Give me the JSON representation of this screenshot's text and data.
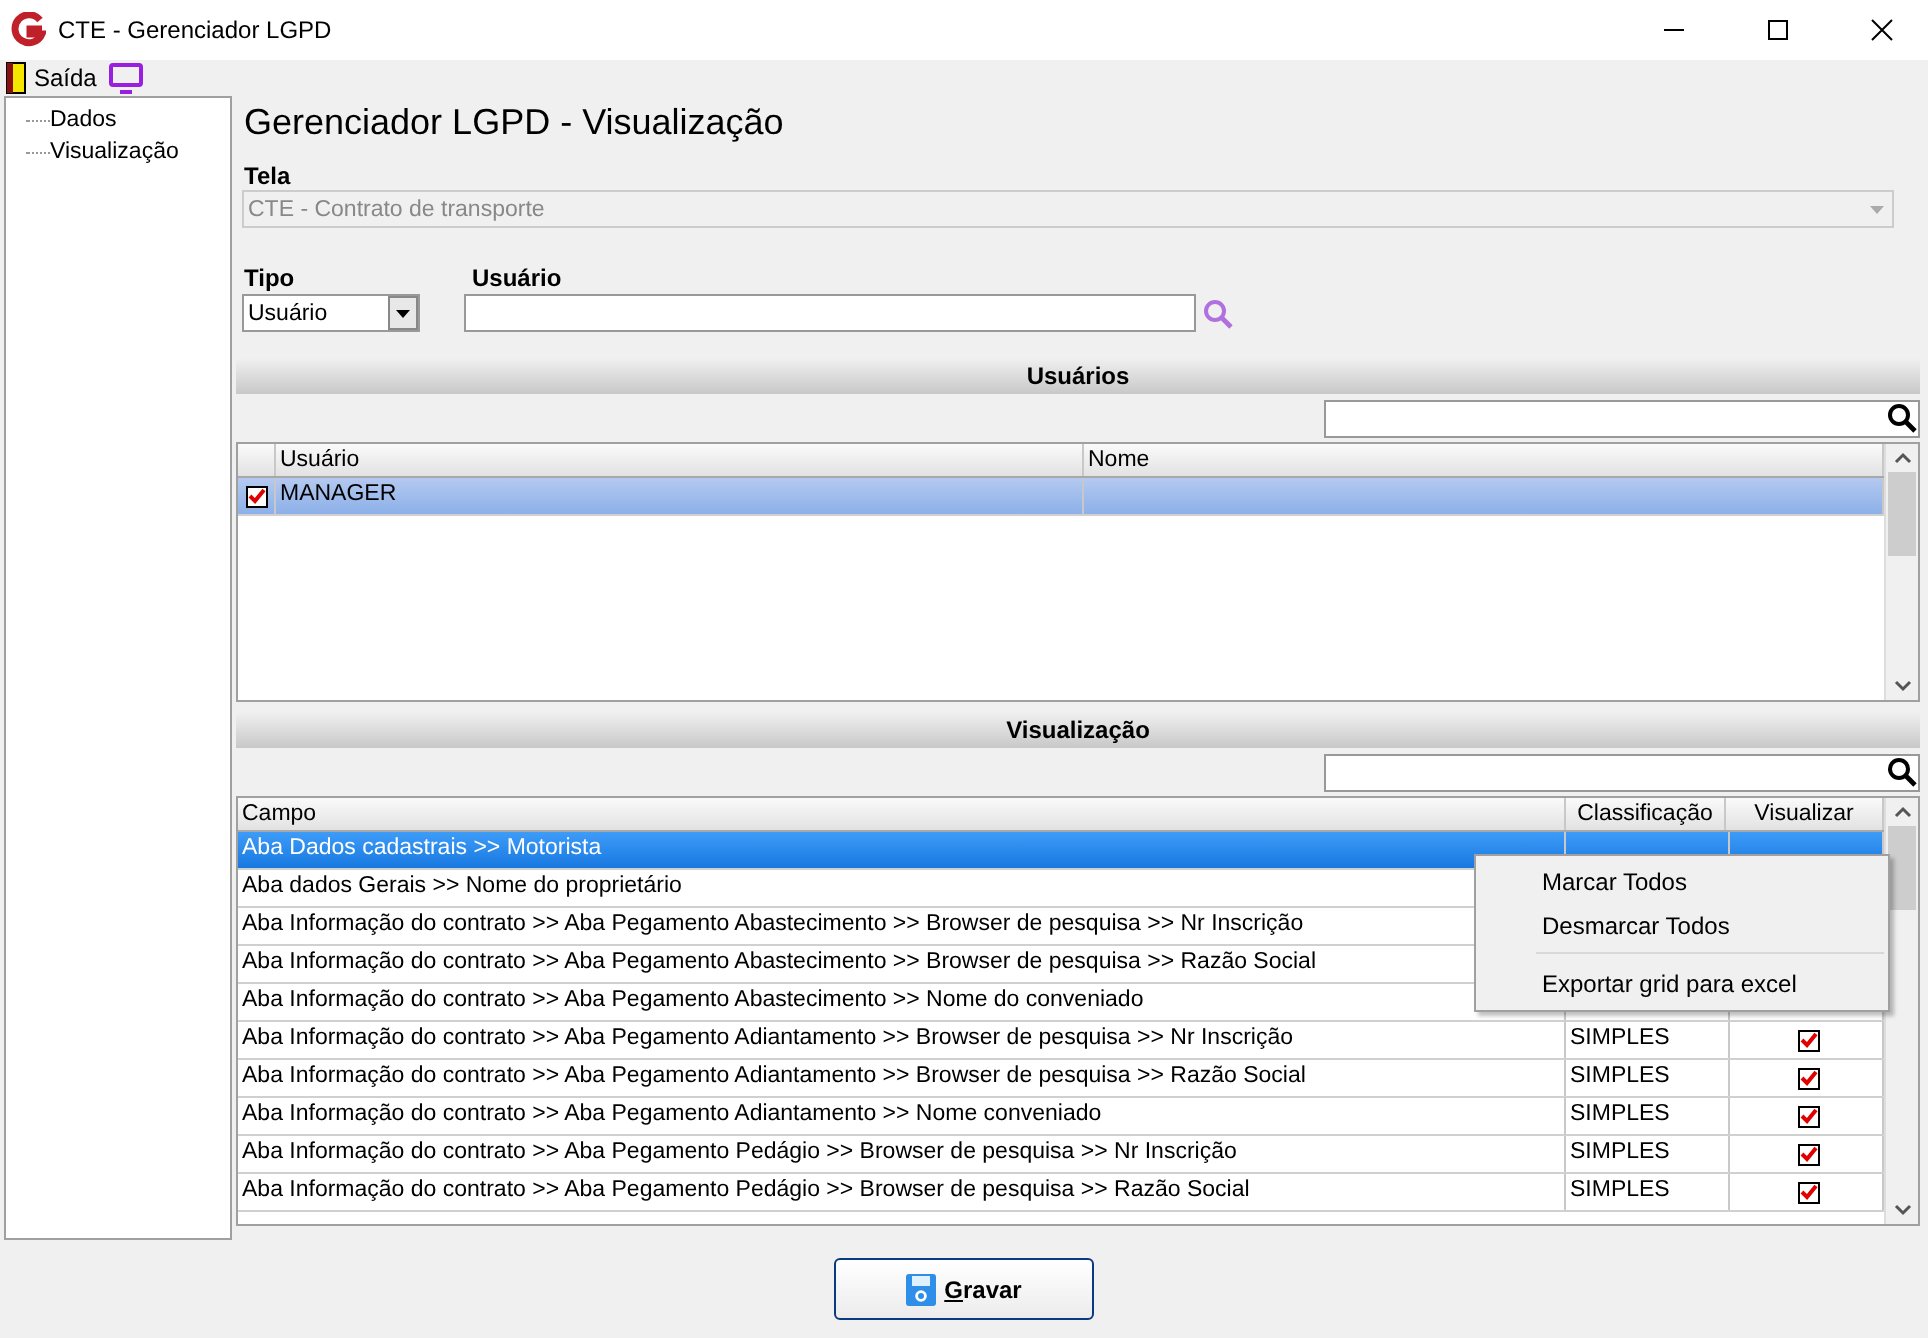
{
  "window": {
    "title": "CTE - Gerenciador LGPD"
  },
  "toolbar": [
    {
      "kind": "exit",
      "label": "Saída"
    },
    {
      "kind": "screen"
    }
  ],
  "sidebar": {
    "items": [
      {
        "label": "Dados"
      },
      {
        "label": "Visualização"
      }
    ]
  },
  "heading": "Gerenciador LGPD - Visualização",
  "tela": {
    "label": "Tela",
    "value": "CTE - Contrato de transporte",
    "disabled": true
  },
  "tipo": {
    "label": "Tipo",
    "value": "Usuário"
  },
  "usuario": {
    "label": "Usuário"
  },
  "usuarios": {
    "title": "Usuários",
    "columns": [
      "Usuário",
      "Nome"
    ],
    "rows": [
      {
        "checked": true,
        "selected": true,
        "cells": [
          "MANAGER",
          ""
        ]
      }
    ]
  },
  "visualizacao": {
    "title": "Visualização",
    "columns": [
      "Campo",
      "Classificação",
      "Visualizar"
    ],
    "rows": [
      {
        "selected": true,
        "campo": "Aba Dados cadastrais >> Motorista"
      },
      {
        "selected": false,
        "campo": "Aba dados Gerais >> Nome do proprietário"
      },
      {
        "selected": false,
        "campo": "Aba Informação do contrato >> Aba Pegamento Abastecimento >> Browser de pesquisa >> Nr Inscrição"
      },
      {
        "selected": false,
        "campo": "Aba Informação do contrato >> Aba Pegamento Abastecimento >> Browser de pesquisa >> Razão Social"
      },
      {
        "selected": false,
        "campo": "Aba Informação do contrato >> Aba Pegamento Abastecimento >> Nome do conveniado"
      },
      {
        "selected": false,
        "campo": "Aba Informação do contrato >> Aba Pegamento Adiantamento >> Browser de pesquisa >> Nr Inscrição",
        "classificacao": "SIMPLES",
        "checked": true
      },
      {
        "selected": false,
        "campo": "Aba Informação do contrato >> Aba Pegamento Adiantamento >> Browser de pesquisa >> Razão Social",
        "classificacao": "SIMPLES",
        "checked": true
      },
      {
        "selected": false,
        "campo": "Aba Informação do contrato >> Aba Pegamento Adiantamento >> Nome conveniado",
        "classificacao": "SIMPLES",
        "checked": true
      },
      {
        "selected": false,
        "campo": "Aba Informação do contrato >> Aba Pegamento Pedágio >> Browser de pesquisa >> Nr Inscrição",
        "classificacao": "SIMPLES",
        "checked": true
      },
      {
        "selected": false,
        "campo": "Aba Informação do contrato >> Aba Pegamento Pedágio >> Browser de pesquisa >> Razão Social",
        "classificacao": "SIMPLES",
        "checked": true
      }
    ]
  },
  "context_menu": [
    {
      "kind": "item",
      "label": "Marcar Todos"
    },
    {
      "kind": "item",
      "label": "Desmarcar Todos"
    },
    {
      "kind": "separator"
    },
    {
      "kind": "item",
      "label": "Exportar grid para excel"
    }
  ],
  "buttons": [
    {
      "label": "Gravar"
    }
  ]
}
